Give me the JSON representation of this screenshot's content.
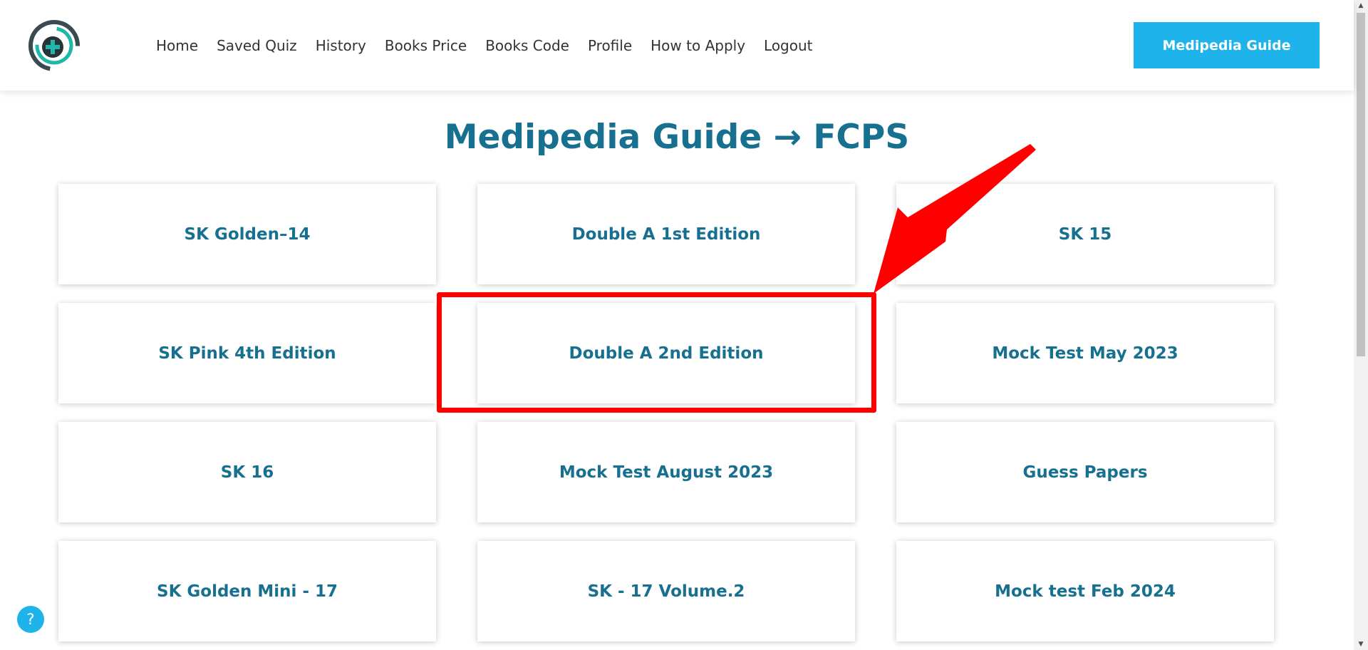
{
  "header": {
    "logo_icon": "medical-plus-icon",
    "nav": [
      "Home",
      "Saved Quiz",
      "History",
      "Books Price",
      "Books Code",
      "Profile",
      "How to Apply",
      "Logout"
    ],
    "cta_label": "Medipedia Guide"
  },
  "page": {
    "title_main": "Medipedia Guide",
    "title_arrow": "→",
    "title_section": "FCPS"
  },
  "cards": [
    "SK Golden–14",
    "Double A 1st Edition",
    "SK 15",
    "SK Pink 4th Edition",
    "Double A 2nd Edition",
    "Mock Test May 2023",
    "SK 16",
    "Mock Test August 2023",
    "Guess Papers",
    "SK Golden Mini - 17",
    "SK - 17 Volume.2",
    "Mock test Feb 2024"
  ],
  "annotation": {
    "highlighted_card": "Double A 2nd Edition",
    "color": "#ff0000"
  },
  "help": {
    "label": "?"
  },
  "colors": {
    "brand": "#17708f",
    "accent": "#1fb3ec",
    "logo_teal": "#1fb8a8",
    "logo_dark": "#3a4a52"
  }
}
